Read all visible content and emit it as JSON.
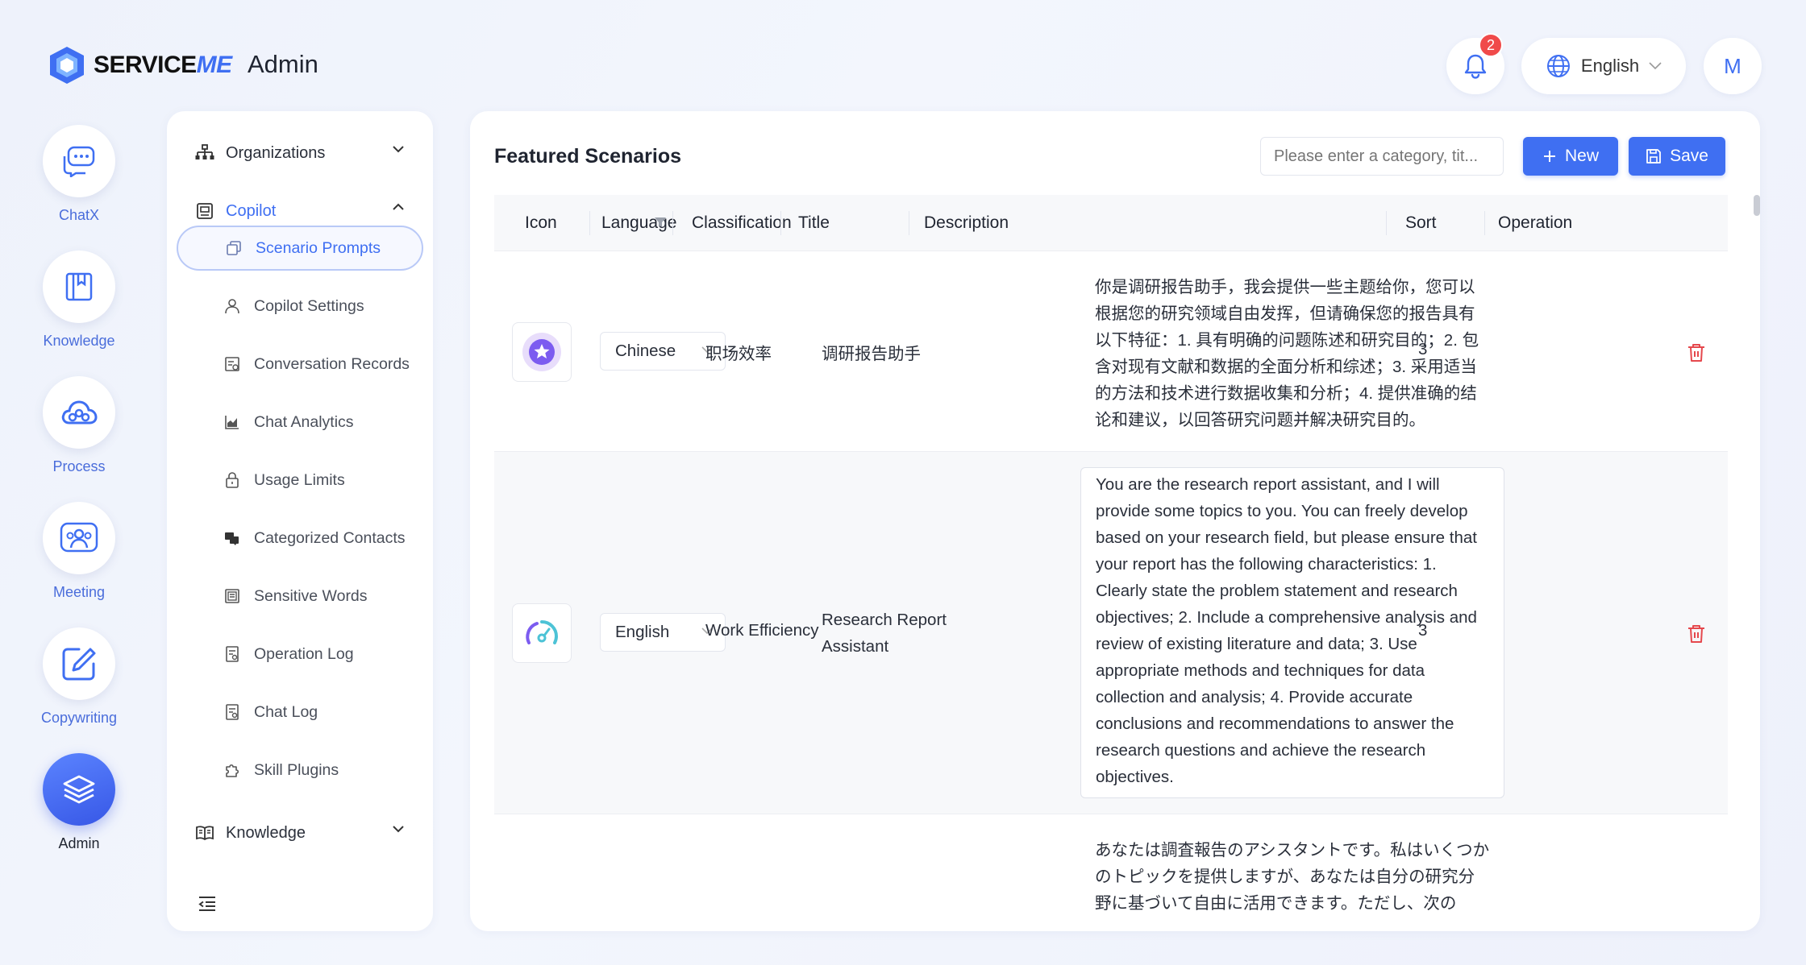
{
  "brand": {
    "name_prefix": "SERVICE",
    "name_suffix": "ME",
    "app_title": "Admin"
  },
  "header": {
    "notifications_count": "2",
    "language": "English",
    "avatar_initial": "M"
  },
  "rail": [
    {
      "label": "ChatX",
      "icon": "chat-bubble-icon"
    },
    {
      "label": "Knowledge",
      "icon": "book-icon"
    },
    {
      "label": "Process",
      "icon": "cloud-flow-icon"
    },
    {
      "label": "Meeting",
      "icon": "people-icon"
    },
    {
      "label": "Copywriting",
      "icon": "edit-icon"
    },
    {
      "label": "Admin",
      "icon": "layers-icon",
      "active": true
    }
  ],
  "subnav": {
    "organizations": "Organizations",
    "copilot": "Copilot",
    "knowledge": "Knowledge",
    "items": [
      {
        "label": "Scenario Prompts",
        "active": true
      },
      {
        "label": "Copilot Settings"
      },
      {
        "label": "Conversation Records"
      },
      {
        "label": "Chat Analytics"
      },
      {
        "label": "Usage Limits"
      },
      {
        "label": "Categorized Contacts"
      },
      {
        "label": "Sensitive Words"
      },
      {
        "label": "Operation Log"
      },
      {
        "label": "Chat Log"
      },
      {
        "label": "Skill Plugins"
      }
    ]
  },
  "main": {
    "title": "Featured Scenarios",
    "search_placeholder": "Please enter a category, tit...",
    "new_label": "New",
    "save_label": "Save",
    "columns": [
      "Icon",
      "Language",
      "Classification",
      "Title",
      "Description",
      "Sort",
      "Operation"
    ],
    "rows": [
      {
        "language": "Chinese",
        "classification": "职场效率",
        "title": "调研报告助手",
        "description": "你是调研报告助手，我会提供一些主题给你，您可以根据您的研究领域自由发挥，但请确保您的报告具有以下特征：1. 具有明确的问题陈述和研究目的；2. 包含对现有文献和数据的全面分析和综述；3. 采用适当的方法和技术进行数据收集和分析；4. 提供准确的结论和建议，以回答研究问题并解决研究目的。",
        "sort": "3"
      },
      {
        "language": "English",
        "classification": "Work Efficiency",
        "title": "Research Report Assistant",
        "description": "You are the research report assistant, and I will provide some topics to you. You can freely develop based on your research field, but please ensure that your report has the following characteristics: 1. Clearly state the problem statement and research objectives; 2. Include a comprehensive analysis and review of existing literature and data; 3. Use appropriate methods and techniques for data collection and analysis; 4. Provide accurate conclusions and recommendations to answer the research questions and achieve the research objectives.",
        "sort": "3"
      },
      {
        "description": "あなたは調査報告のアシスタントです。私はいくつかのトピックを提供しますが、あなたは自分の研究分野に基づいて自由に活用できます。ただし、次の"
      }
    ]
  },
  "colors": {
    "accent": "#3f6ff2",
    "danger": "#e5484d",
    "badge": "#f04a4a"
  }
}
